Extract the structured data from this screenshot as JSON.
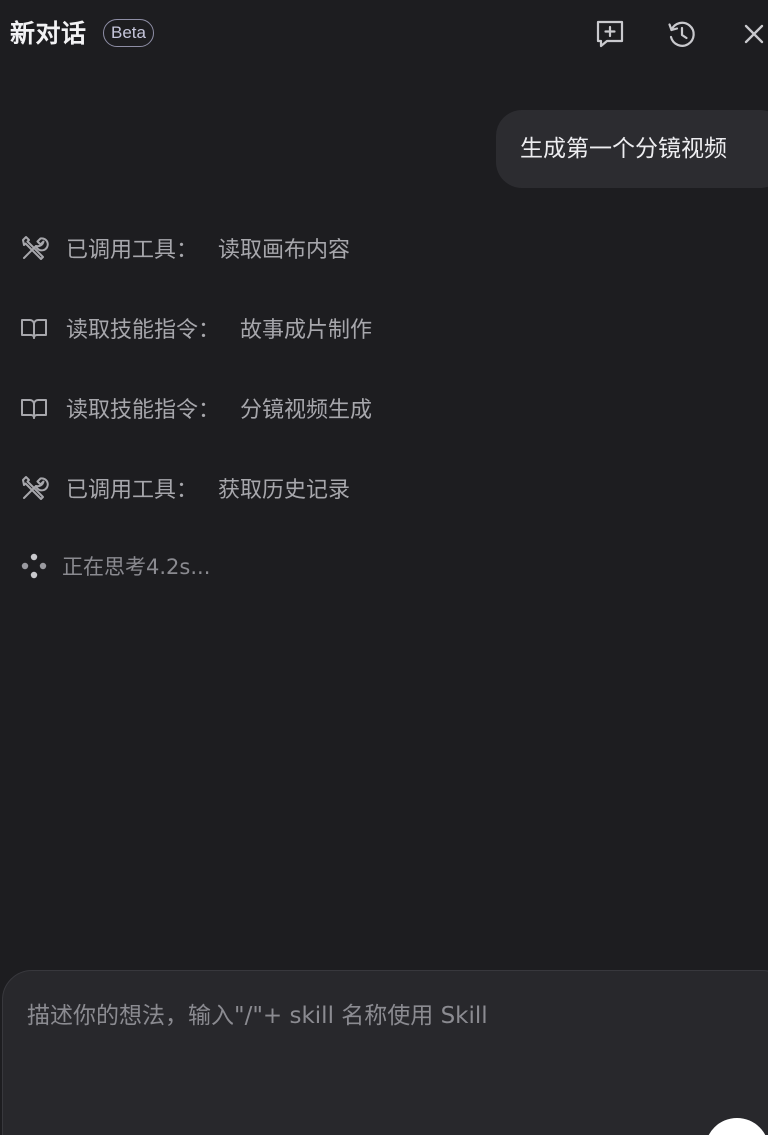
{
  "header": {
    "title": "新对话",
    "badge": "Beta",
    "icons": [
      "new-chat-icon",
      "history-icon",
      "close-icon"
    ]
  },
  "messages": {
    "user": "生成第一个分镜视频"
  },
  "steps": [
    {
      "icon": "tools-icon",
      "prefix": "已调用工具：",
      "detail": "读取画布内容"
    },
    {
      "icon": "book-icon",
      "prefix": "读取技能指令：",
      "detail": "故事成片制作"
    },
    {
      "icon": "book-icon",
      "prefix": "读取技能指令：",
      "detail": "分镜视频生成"
    },
    {
      "icon": "tools-icon",
      "prefix": "已调用工具：",
      "detail": "获取历史记录"
    }
  ],
  "thinking": {
    "icon": "thinking-dots-icon",
    "text": "正在思考4.2s..."
  },
  "input": {
    "value": "",
    "placeholder": "描述你的想法，输入\"/\"+ skill 名称使用 Skill"
  },
  "colors": {
    "background": "#1d1d20",
    "bubble": "#2c2c30",
    "input_panel": "#28282c",
    "muted_text": "#a7a7ac"
  }
}
